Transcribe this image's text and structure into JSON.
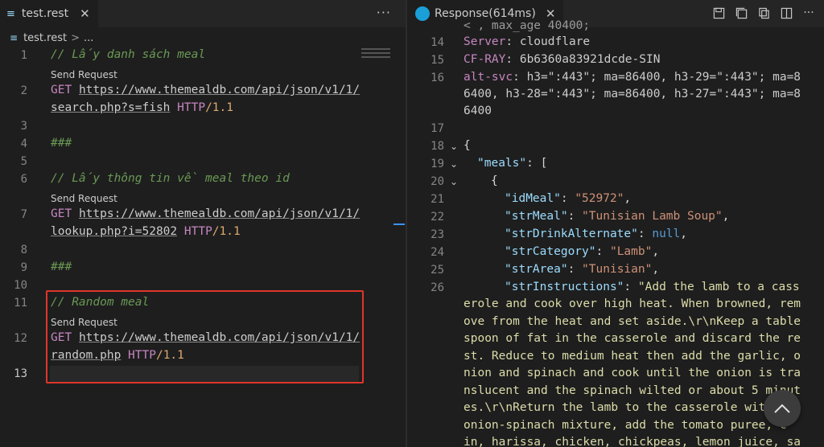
{
  "left": {
    "tab": {
      "label": "test.rest",
      "close": "✕"
    },
    "more": "···",
    "breadcrumb": {
      "file": "test.rest",
      "sep": ">",
      "rest": "..."
    },
    "codelens": "Send Request",
    "lines": {
      "l1": "// Lấy danh sách meal",
      "l2a_method": "GET",
      "l2a_url": "https://www.themealdb.com/api/json/v1/1/",
      "l2b_url": "search.php?s=fish",
      "l2_proto": "HTTP",
      "l2_ver": "/1.1",
      "l4": "###",
      "l6": "// Lấy thông tin về meal theo id",
      "l7a_url": "https://www.themealdb.com/api/json/v1/1/",
      "l7b_url": "lookup.php?i=52802",
      "l9": "###",
      "l11": "// Random meal",
      "l12a_url": "https://www.themealdb.com/api/json/v1/1/",
      "l12b_url": "random.php"
    },
    "numbers": [
      "1",
      "2",
      "3",
      "4",
      "5",
      "6",
      "7",
      "8",
      "9",
      "10",
      "11",
      "12",
      "13"
    ]
  },
  "right": {
    "tab": {
      "label": "Response(614ms)",
      "close": "✕"
    },
    "numbers": [
      "14",
      "15",
      "16",
      "17",
      "18",
      "19",
      "20",
      "21",
      "22",
      "23",
      "24",
      "25",
      "26"
    ],
    "partial_top": "< , max_age 40400;",
    "h14": {
      "key": "Server",
      "val": ": cloudflare"
    },
    "h15": {
      "key": "CF-RAY",
      "val": ": 6b6360a83921dcde-SIN"
    },
    "h16": {
      "key": "alt-svc",
      "val": ": h3=\":443\"; ma=86400, h3-29=\":443\"; ma=8",
      "wrap1": "6400, h3-28=\":443\"; ma=86400, h3-27=\":443\"; ma=8",
      "wrap2": "6400"
    },
    "j18": "{",
    "j19": {
      "key": "\"meals\"",
      "rest": ": ["
    },
    "j20": "{",
    "j21": {
      "key": "\"idMeal\"",
      "val": "\"52972\""
    },
    "j22": {
      "key": "\"strMeal\"",
      "val": "\"Tunisian Lamb Soup\""
    },
    "j23": {
      "key": "\"strDrinkAlternate\"",
      "val": "null"
    },
    "j24": {
      "key": "\"strCategory\"",
      "val": "\"Lamb\""
    },
    "j25": {
      "key": "\"strArea\"",
      "val": "\"Tunisian\""
    },
    "j26": {
      "key": "\"strInstructions\"",
      "val": "\"Add the lamb to a cass"
    },
    "wrap": [
      "erole and cook over high heat. When browned, rem",
      "ove from the heat and set aside.\\r\\nKeep a table",
      "spoon of fat in the casserole and discard the re",
      "st. Reduce to medium heat then add the garlic, o",
      "nion and spinach and cook until the onion is tra",
      "nslucent and the spinach wilted or about 5 minut",
      "es.\\r\\nReturn the lamb to the casserole with",
      "onion-spinach mixture, add the tomato puree, c",
      "in, harissa, chicken, chickpeas, lemon juice, sa"
    ]
  },
  "colors": {
    "accent": "#3794ff",
    "highlight_border": "#e0352b"
  }
}
